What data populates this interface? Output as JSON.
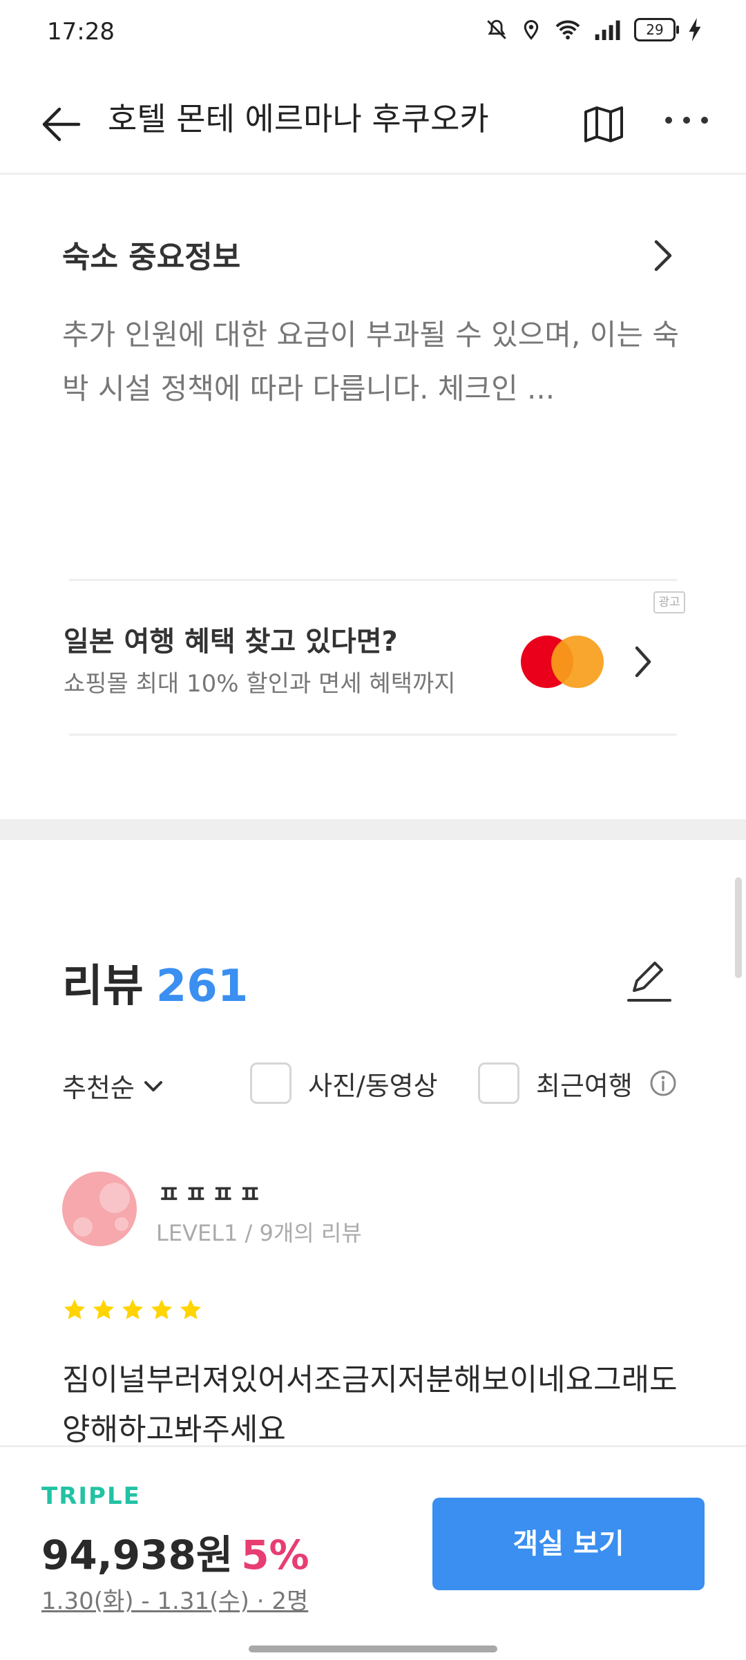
{
  "status": {
    "time": "17:28",
    "battery": "29"
  },
  "header": {
    "title": "호텔 몬테 에르마나 후쿠오카"
  },
  "notice": {
    "title": "숙소 중요정보",
    "body": "추가 인원에 대한 요금이 부과될 수 있으며, 이는 숙박 시설 정책에 따라 다릅니다. 체크인 ..."
  },
  "ad": {
    "badge": "광고",
    "title": "일본 여행 혜택 찾고 있다면?",
    "subtitle": "쇼핑몰 최대 10% 할인과 면세 혜택까지"
  },
  "reviews": {
    "title": "리뷰",
    "count": "261",
    "sort_label": "추천순",
    "filters": [
      {
        "label": "사진/동영상",
        "checked": false
      },
      {
        "label": "최근여행",
        "checked": false
      }
    ],
    "items": [
      {
        "user": "ㅍㅍㅍㅍ",
        "meta": "LEVEL1 / 9개의 리뷰",
        "rating": 5,
        "text": "짐이널부러져있어서조금지저분해보이네요그래도양해하고봐주세요"
      }
    ]
  },
  "booking": {
    "brand": "TRIPLE",
    "price": "94,938원",
    "discount": "5%",
    "dates": "1.30(화) - 1.31(수) · 2명",
    "cta": "객실 보기"
  },
  "colors": {
    "accent": "#3a8ff0",
    "brand": "#22c2a4",
    "discount": "#e83d72",
    "star": "#ffd400"
  }
}
